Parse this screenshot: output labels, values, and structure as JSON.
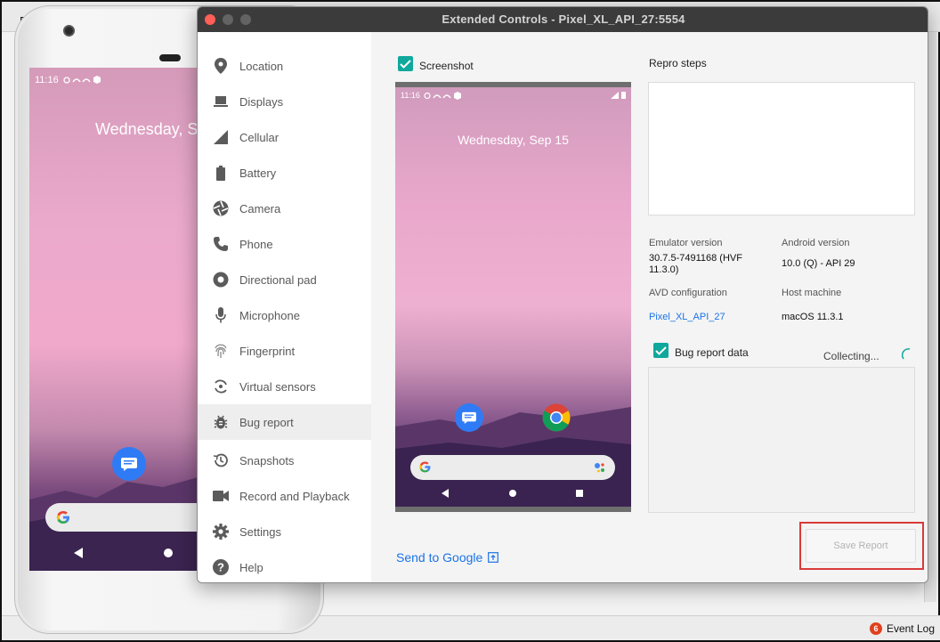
{
  "ide": {
    "tab_text_partial": "Ed",
    "event_log_label": "Event Log",
    "event_log_badge": "6"
  },
  "phone": {
    "time": "11:16",
    "date_partial": "Wednesday, S"
  },
  "window": {
    "title": "Extended Controls - Pixel_XL_API_27:5554"
  },
  "sidebar": {
    "items": [
      {
        "label": "Location",
        "icon": "location-pin-icon"
      },
      {
        "label": "Displays",
        "icon": "laptop-icon"
      },
      {
        "label": "Cellular",
        "icon": "signal-icon"
      },
      {
        "label": "Battery",
        "icon": "battery-icon"
      },
      {
        "label": "Camera",
        "icon": "camera-aperture-icon"
      },
      {
        "label": "Phone",
        "icon": "phone-icon"
      },
      {
        "label": "Directional pad",
        "icon": "dpad-icon"
      },
      {
        "label": "Microphone",
        "icon": "microphone-icon"
      },
      {
        "label": "Fingerprint",
        "icon": "fingerprint-icon"
      },
      {
        "label": "Virtual sensors",
        "icon": "rotate-icon"
      },
      {
        "label": "Bug report",
        "icon": "bug-icon",
        "active": true
      },
      {
        "label": "Snapshots",
        "icon": "history-icon"
      },
      {
        "label": "Record and Playback",
        "icon": "video-camera-icon"
      },
      {
        "label": "Settings",
        "icon": "gear-icon"
      },
      {
        "label": "Help",
        "icon": "help-icon"
      }
    ]
  },
  "bug_report": {
    "screenshot_label": "Screenshot",
    "screenshot_checked": true,
    "screenshot_time": "11:16",
    "screenshot_date": "Wednesday, Sep 15",
    "send_to_google": "Send to Google",
    "repro_steps_label": "Repro steps",
    "emulator_version_label": "Emulator version",
    "emulator_version_value": "30.7.5-7491168 (HVF 11.3.0)",
    "android_version_label": "Android version",
    "android_version_value": "10.0 (Q) - API 29",
    "avd_config_label": "AVD configuration",
    "avd_config_value": "Pixel_XL_API_27",
    "host_machine_label": "Host machine",
    "host_machine_value": "macOS 11.3.1",
    "bug_report_data_label": "Bug report data",
    "bug_report_data_checked": true,
    "collecting_text": "Collecting...",
    "save_report_label": "Save Report"
  },
  "colors": {
    "accent_teal": "#10a89c",
    "link_blue": "#1a73e8",
    "highlight_red": "#d93a3a"
  }
}
